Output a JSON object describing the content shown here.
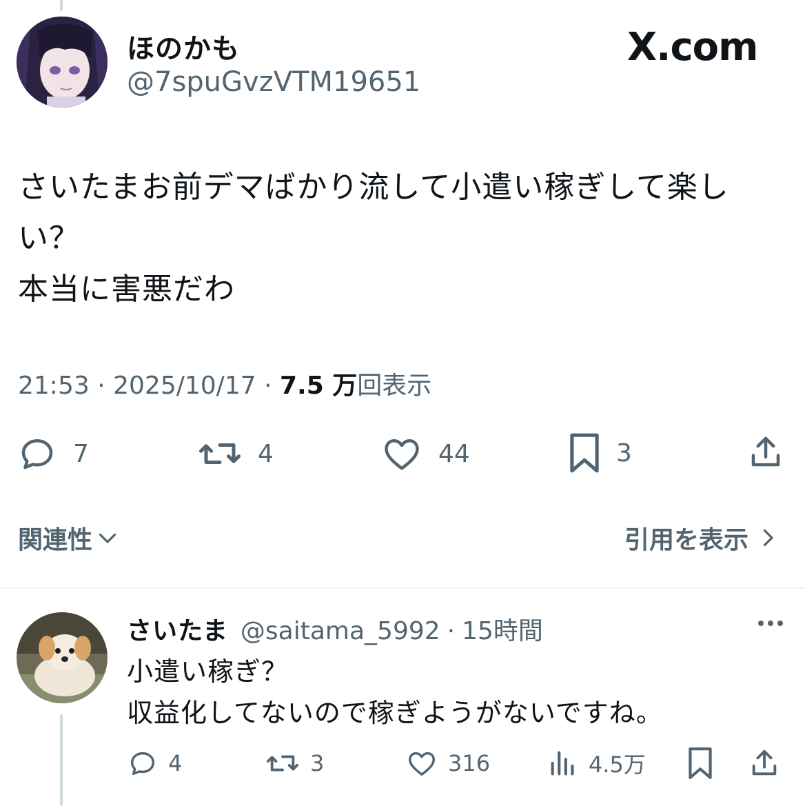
{
  "post": {
    "display_name": "ほのかも",
    "handle": "@7spuGvzVTM19651",
    "site_logo": "X.com",
    "text_lines": [
      "さいたまお前デマばかり流して小遣い稼ぎして楽し",
      "い？",
      "本当に害悪だわ"
    ],
    "time": "21:53",
    "date": "2025/10/17",
    "views_count": "7.5 万",
    "views_label": "回表示",
    "separator": "·",
    "replies": "7",
    "reposts": "4",
    "likes": "44",
    "bookmarks": "3"
  },
  "related_label": "関連性",
  "quotes_label": "引用を表示",
  "reply": {
    "display_name": "さいたま",
    "handle": "@saitama_5992",
    "time_ago": "15時間",
    "separator": "·",
    "text_lines": [
      "小遣い稼ぎ？",
      "収益化してないので稼ぎようがないですね。"
    ],
    "replies": "4",
    "reposts": "3",
    "likes": "316",
    "views": "4.5万"
  },
  "colors": {
    "text": "#0f1419",
    "muted": "#536471",
    "divider": "#eff3f4",
    "thread_line": "#cfd9de"
  },
  "icons": [
    "reply-icon",
    "repost-icon",
    "like-icon",
    "bookmark-icon",
    "share-icon",
    "views-icon",
    "more-icon",
    "chevron-down-icon",
    "chevron-right-icon"
  ]
}
